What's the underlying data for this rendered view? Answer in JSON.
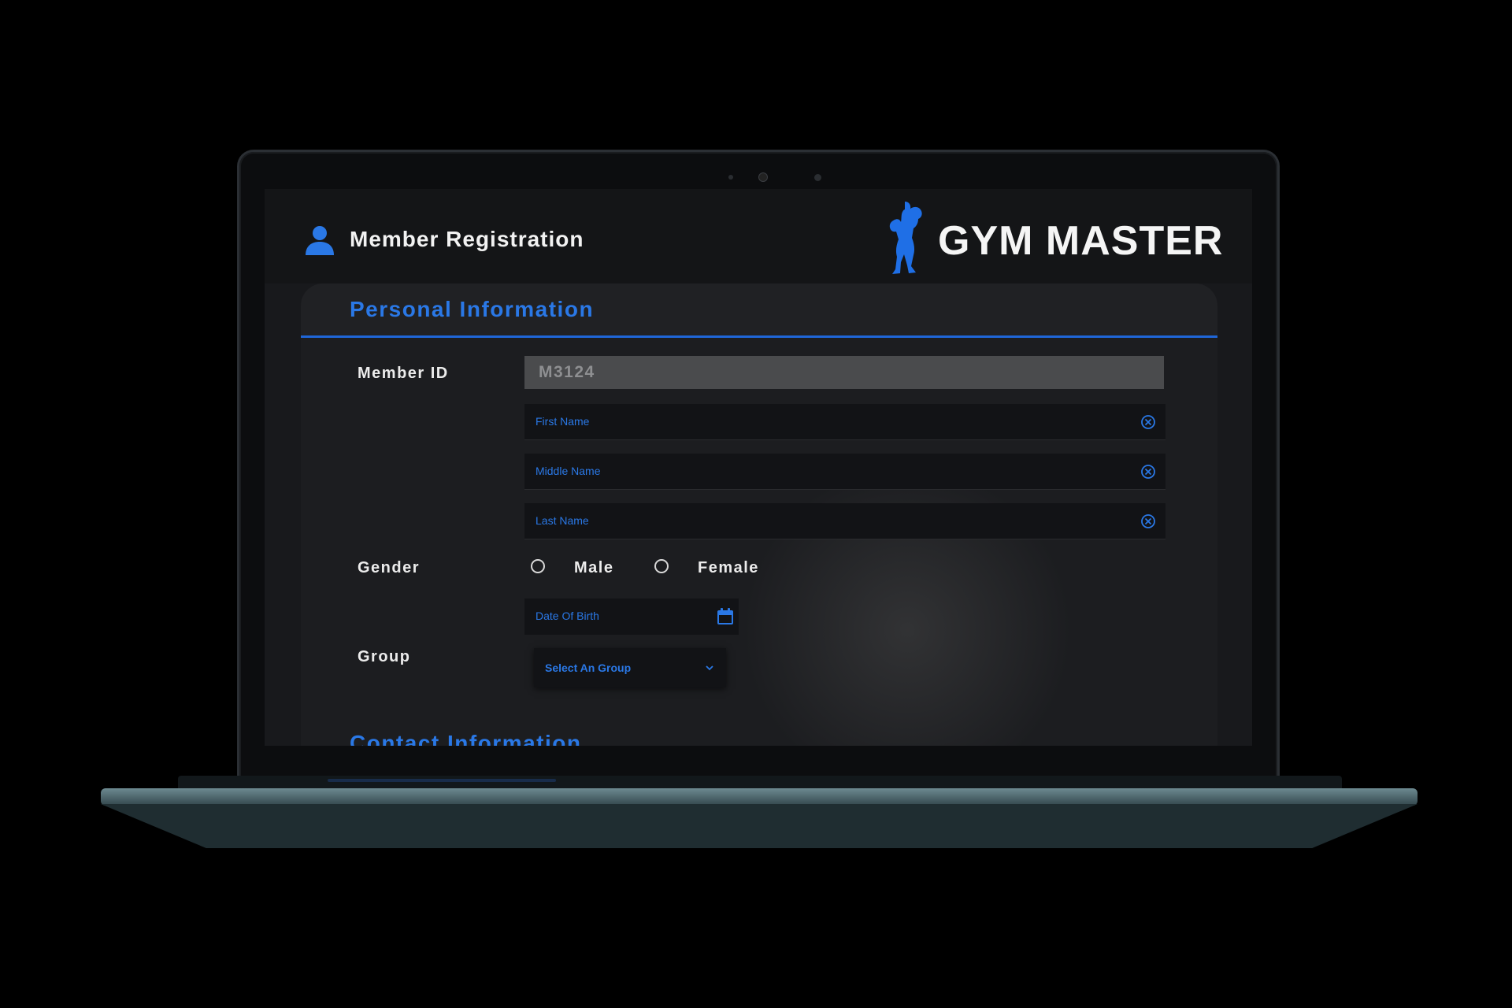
{
  "header": {
    "title": "Member Registration",
    "user_icon": "user-icon",
    "brand": {
      "name": "GYM MASTER",
      "logo_icon": "bodybuilder-logo"
    }
  },
  "personal_info": {
    "section_title": "Personal Information",
    "member_id": {
      "label": "Member ID",
      "value": "M3124"
    },
    "first_name": {
      "label": "First Name",
      "value": ""
    },
    "middle_name": {
      "label": "Middle Name",
      "value": ""
    },
    "last_name": {
      "label": "Last Name",
      "value": ""
    },
    "gender": {
      "label": "Gender",
      "options": [
        "Male",
        "Female"
      ],
      "selected": null
    },
    "date_of_birth": {
      "label": "Date Of Birth",
      "value": ""
    },
    "group": {
      "label": "Group",
      "placeholder": "Select An Group"
    }
  },
  "next_section": {
    "title": "Contact Information"
  },
  "colors": {
    "accent": "#2a78e6",
    "background": "#18191c",
    "field_bg": "#121316",
    "text": "#ececec"
  }
}
